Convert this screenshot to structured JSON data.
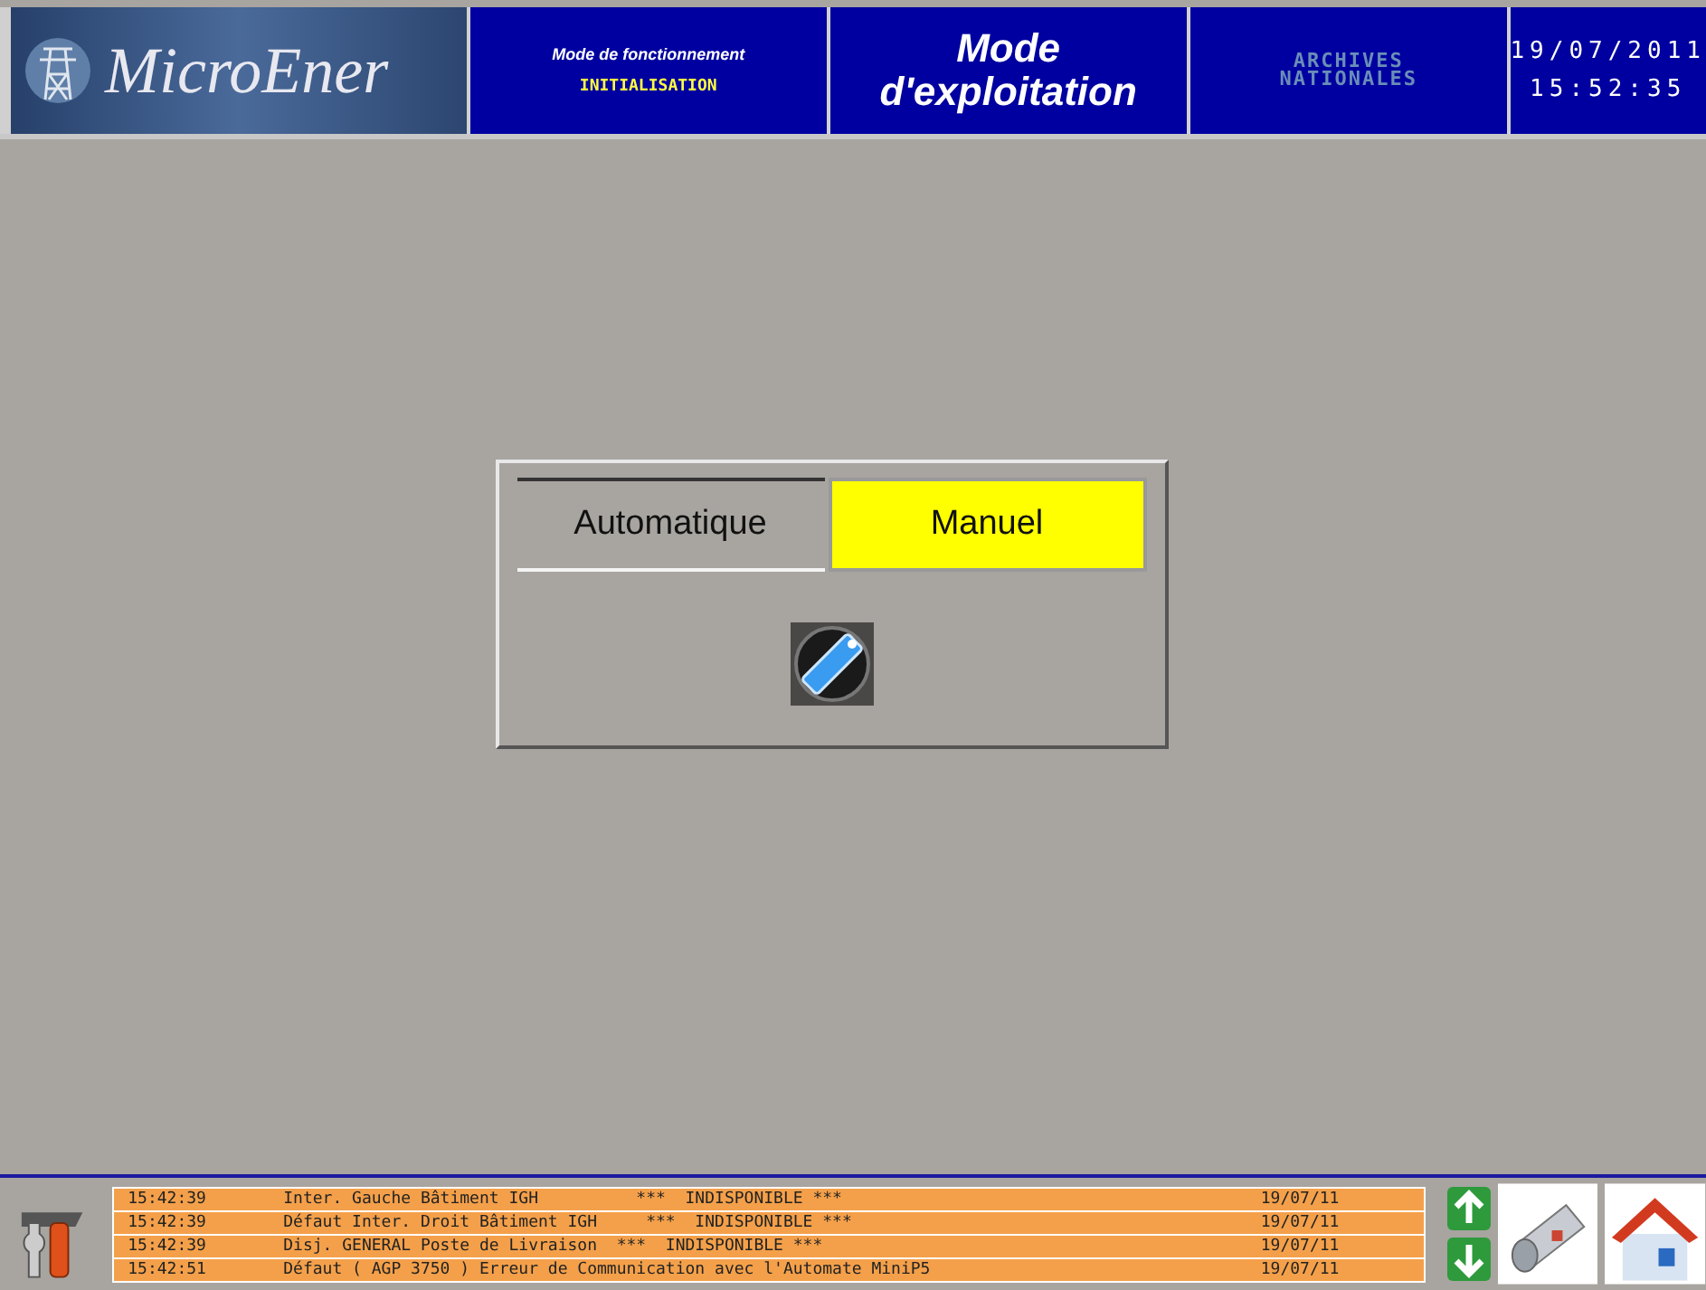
{
  "header": {
    "logo": "MicroEner",
    "mode_label": "Mode de fonctionnement",
    "mode_value": "INITIALISATION",
    "title_line1": "Mode",
    "title_line2": "d'exploitation",
    "archives_line1": "ARCHIVES",
    "archives_line2": "NATIONALES",
    "date": "19/07/2011",
    "time": "15:52:35"
  },
  "mode_selector": {
    "options": [
      {
        "label": "Automatique",
        "selected": false
      },
      {
        "label": "Manuel",
        "selected": true
      }
    ]
  },
  "alarms": [
    {
      "time": "15:42:39",
      "message": "Inter. Gauche Bâtiment IGH          ***  INDISPONIBLE ***",
      "date": "19/07/11"
    },
    {
      "time": "15:42:39",
      "message": "Défaut Inter. Droit Bâtiment IGH     ***  INDISPONIBLE ***",
      "date": "19/07/11"
    },
    {
      "time": "15:42:39",
      "message": "Disj. GENERAL Poste de Livraison  ***  INDISPONIBLE ***",
      "date": "19/07/11"
    },
    {
      "time": "15:42:51",
      "message": "Défaut ( AGP 3750 ) Erreur de Communication avec l'Automate MiniP5",
      "date": "19/07/11"
    }
  ]
}
